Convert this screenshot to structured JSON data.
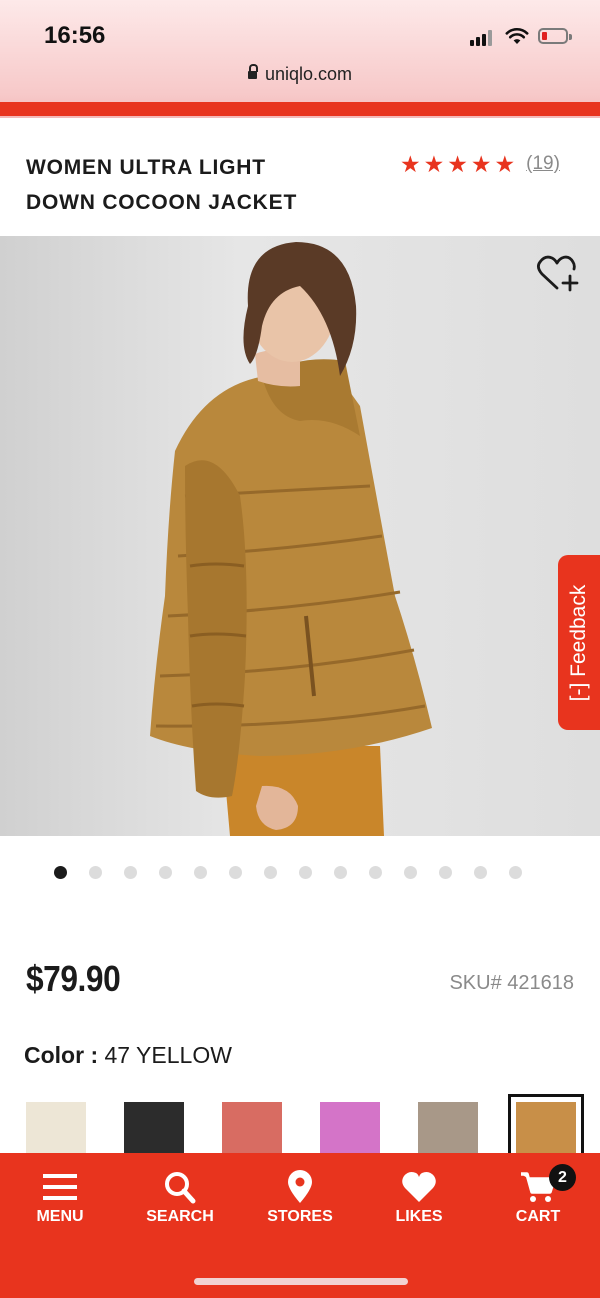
{
  "status_bar": {
    "time": "16:56",
    "url": "uniqlo.com"
  },
  "product": {
    "title_line1": "WOMEN ULTRA LIGHT",
    "title_line2": "DOWN COCOON JACKET",
    "rating_value": 5,
    "rating_max": 5,
    "review_count": "(19)",
    "price": "$79.90",
    "sku": "SKU# 421618",
    "color_label": "Color :",
    "color_value": "47 YELLOW"
  },
  "gallery": {
    "image_count": 14,
    "current_index": 0
  },
  "feedback_tab": {
    "label": "[-] Feedback"
  },
  "swatches": [
    {
      "color": "#ede6d6"
    },
    {
      "color": "#2c2c2c"
    },
    {
      "color": "#d86c62"
    },
    {
      "color": "#d474c8"
    },
    {
      "color": "#a89888"
    },
    {
      "color": "#c88f48",
      "selected": true
    }
  ],
  "tab_bar": {
    "menu": "MENU",
    "search": "SEARCH",
    "stores": "STORES",
    "likes": "LIKES",
    "cart": "CART",
    "cart_count": "2"
  },
  "colors": {
    "accent": "#e8341e",
    "text": "#1b1b1b",
    "muted": "#8a8a8a"
  }
}
